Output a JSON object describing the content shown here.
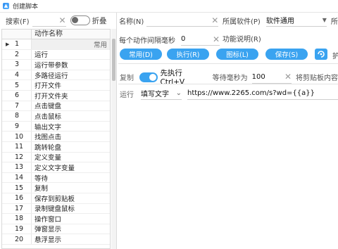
{
  "window": {
    "title": "创建脚本"
  },
  "left": {
    "search_label": "搜索(F)",
    "fold_label": "折叠",
    "grid_header": "动作名称",
    "rows": [
      {
        "idx": "1",
        "name": "",
        "category": "常用",
        "selected": true
      },
      {
        "idx": "2",
        "name": "运行"
      },
      {
        "idx": "3",
        "name": "运行带参数"
      },
      {
        "idx": "4",
        "name": "多路径运行"
      },
      {
        "idx": "5",
        "name": "打开文件"
      },
      {
        "idx": "6",
        "name": "打开文件夹"
      },
      {
        "idx": "7",
        "name": "点击键盘"
      },
      {
        "idx": "8",
        "name": "点击鼠标"
      },
      {
        "idx": "9",
        "name": "输出文字"
      },
      {
        "idx": "10",
        "name": "找图点击"
      },
      {
        "idx": "11",
        "name": "跳转轮盘"
      },
      {
        "idx": "12",
        "name": "定义变量"
      },
      {
        "idx": "13",
        "name": "定义文字变量"
      },
      {
        "idx": "14",
        "name": "等待"
      },
      {
        "idx": "15",
        "name": "复制"
      },
      {
        "idx": "16",
        "name": "保存到剪贴板"
      },
      {
        "idx": "17",
        "name": "录制键盘鼠标"
      },
      {
        "idx": "18",
        "name": "操作窗口"
      },
      {
        "idx": "19",
        "name": "弹窗显示"
      },
      {
        "idx": "20",
        "name": "悬浮显示"
      }
    ]
  },
  "form": {
    "name_label": "名称(N)",
    "software_label": "所属软件(P)",
    "software_value": "软件通用",
    "cut_label": "所",
    "interval_label": "每个动作间隔毫秒",
    "interval_value": "0",
    "desc_label": "功能说明(R)"
  },
  "buttons": {
    "common": "常用(D)",
    "execute": "执行(R)",
    "icon": "图标(L)",
    "save": "保存(S)",
    "cut_text": "护"
  },
  "copy_row": {
    "label": "复制",
    "pre_exec": "先执行Ctrl+V",
    "wait_label": "等待毫秒为",
    "wait_value": "100",
    "clip_label": "将剪贴板内容"
  },
  "run_row": {
    "label": "运行",
    "mode_value": "填写文字",
    "text_value": "https://www.2265.com/s?wd={{a}}"
  },
  "colors": {
    "accent": "#3aa3f0"
  }
}
